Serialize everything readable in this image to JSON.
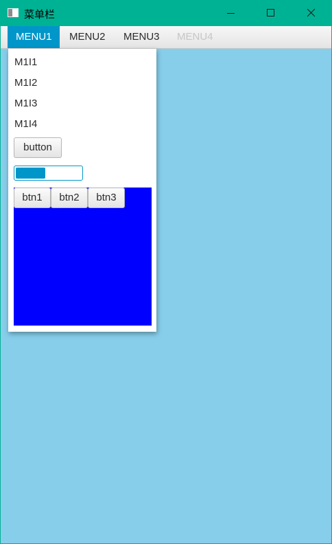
{
  "window": {
    "title": "菜单栏",
    "controls": {
      "minimize_icon": "minimize-icon",
      "maximize_icon": "maximize-icon",
      "close_icon": "close-icon"
    },
    "colors": {
      "titlebar": "#00b294",
      "background": "#87ceeb",
      "accent": "#0096c9",
      "pane": "#0000ff"
    }
  },
  "menubar": {
    "menus": [
      {
        "label": "MENU1",
        "state": "open"
      },
      {
        "label": "MENU2",
        "state": "normal"
      },
      {
        "label": "MENU3",
        "state": "normal"
      },
      {
        "label": "MENU4",
        "state": "disabled"
      }
    ]
  },
  "popup": {
    "items": [
      {
        "label": "M1I1"
      },
      {
        "label": "M1I2"
      },
      {
        "label": "M1I3"
      },
      {
        "label": "M1I4"
      }
    ],
    "button_label": "button",
    "progress": 0.45,
    "pane_buttons": [
      {
        "label": "btn1"
      },
      {
        "label": "btn2"
      },
      {
        "label": "btn3"
      }
    ]
  }
}
